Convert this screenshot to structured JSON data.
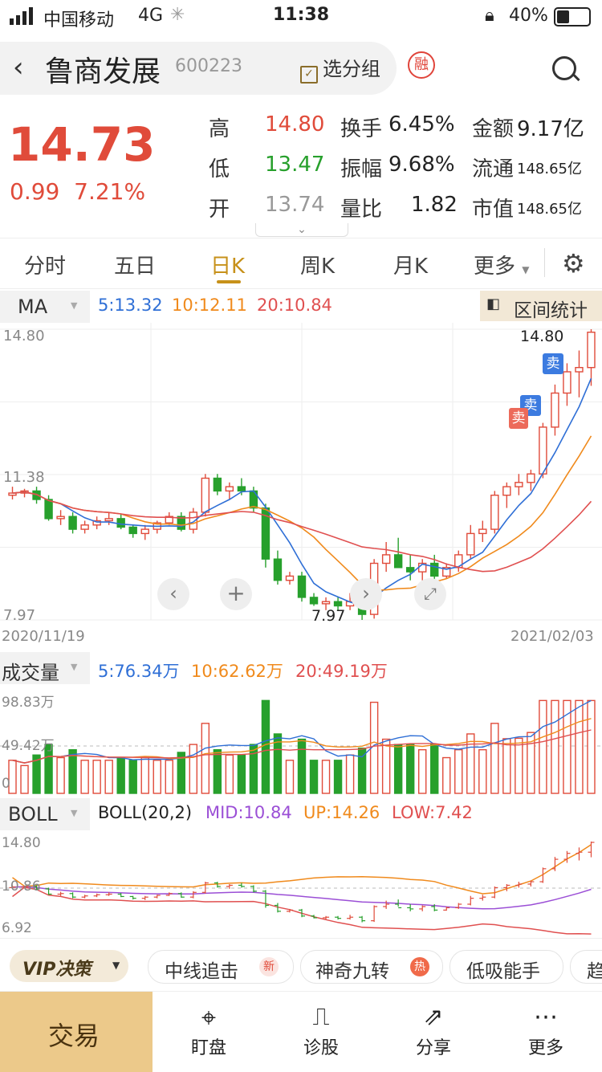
{
  "status": {
    "carrier": "中国移动",
    "network": "4G",
    "time": "11:38",
    "battery": "40%"
  },
  "header": {
    "title": "鲁商发展",
    "code": "600223",
    "group_label": "选分组",
    "rong": "融"
  },
  "quote": {
    "price": "14.73",
    "change": "0.99",
    "change_pct": "7.21%",
    "high_label": "高",
    "high": "14.80",
    "low_label": "低",
    "low": "13.47",
    "open_label": "开",
    "open": "13.74",
    "turnover_label": "换手",
    "turnover": "6.45%",
    "amplitude_label": "振幅",
    "amplitude": "9.68%",
    "ratio_label": "量比",
    "ratio": "1.82",
    "amount_label": "金额",
    "amount": "9.17亿",
    "float_label": "流通",
    "float_value": "148.65亿",
    "mcap_label": "市值",
    "mcap": "148.65亿"
  },
  "tabs": [
    "分时",
    "五日",
    "日K",
    "周K",
    "月K",
    "更多"
  ],
  "ma": {
    "label": "MA",
    "ma5": "5:13.32",
    "ma10": "10:12.11",
    "ma20": "20:10.84",
    "range_btn": "区间统计",
    "y_top": "14.80",
    "y_mid": "11.38",
    "y_bot": "7.97",
    "max_label": "14.80",
    "min_label": "7.97",
    "date_start": "2020/11/19",
    "date_end": "2021/02/03",
    "sell1": "卖",
    "sell2": "卖",
    "sell3": "卖"
  },
  "volume": {
    "label": "成交量",
    "v5": "5:76.34万",
    "v10": "10:62.62万",
    "v20": "20:49.19万",
    "y_top": "98.83万",
    "y_mid": "49.42万",
    "y_bot": "0"
  },
  "boll": {
    "label": "BOLL",
    "params": "BOLL(20,2)",
    "mid": "MID:10.84",
    "up": "UP:14.26",
    "low": "LOW:7.42",
    "y_top": "14.80",
    "y_mid": "10.86",
    "y_bot": "6.92"
  },
  "strategies": {
    "vip": "VIP决策",
    "items": [
      {
        "label": "中线追击",
        "badge": "新"
      },
      {
        "label": "神奇九转",
        "badge": "热"
      },
      {
        "label": "低吸能手",
        "badge": ""
      },
      {
        "label": "趋",
        "badge": ""
      }
    ]
  },
  "bottom": {
    "trade": "交易",
    "items": [
      "盯盘",
      "诊股",
      "分享",
      "更多"
    ]
  },
  "colors": {
    "up": "#e04b3a",
    "down": "#27a02c",
    "ma5": "#2f6fd6",
    "ma10": "#f08a1c",
    "ma20": "#e05050",
    "accent": "#c7911a",
    "mid": "#9b4fd6"
  },
  "chart_data": {
    "type": "candlestick",
    "ohlc": [
      [
        10.9,
        11.1,
        10.8,
        10.95
      ],
      [
        10.95,
        11.05,
        10.85,
        11.0
      ],
      [
        11.0,
        11.1,
        10.7,
        10.8
      ],
      [
        10.8,
        10.9,
        10.3,
        10.35
      ],
      [
        10.35,
        10.55,
        10.2,
        10.4
      ],
      [
        10.4,
        10.5,
        10.0,
        10.1
      ],
      [
        10.1,
        10.3,
        10.0,
        10.2
      ],
      [
        10.2,
        10.4,
        10.1,
        10.3
      ],
      [
        10.3,
        10.5,
        10.2,
        10.35
      ],
      [
        10.35,
        10.45,
        10.1,
        10.15
      ],
      [
        10.15,
        10.2,
        9.9,
        10.0
      ],
      [
        10.0,
        10.2,
        9.85,
        10.1
      ],
      [
        10.1,
        10.3,
        10.0,
        10.25
      ],
      [
        10.25,
        10.5,
        10.2,
        10.4
      ],
      [
        10.4,
        10.5,
        10.05,
        10.1
      ],
      [
        10.1,
        10.6,
        10.0,
        10.5
      ],
      [
        10.5,
        11.4,
        10.4,
        11.3
      ],
      [
        11.3,
        11.4,
        10.9,
        11.0
      ],
      [
        11.0,
        11.2,
        10.8,
        11.1
      ],
      [
        11.1,
        11.3,
        10.9,
        11.0
      ],
      [
        11.0,
        11.1,
        10.5,
        10.6
      ],
      [
        10.6,
        10.7,
        9.2,
        9.4
      ],
      [
        9.4,
        9.6,
        8.8,
        8.9
      ],
      [
        8.9,
        9.1,
        8.8,
        9.0
      ],
      [
        9.0,
        9.1,
        8.4,
        8.5
      ],
      [
        8.5,
        8.6,
        8.3,
        8.35
      ],
      [
        8.35,
        8.5,
        8.2,
        8.4
      ],
      [
        8.4,
        8.5,
        8.2,
        8.3
      ],
      [
        8.3,
        8.6,
        8.2,
        8.4
      ],
      [
        8.4,
        8.5,
        7.97,
        8.1
      ],
      [
        8.1,
        9.4,
        8.0,
        9.3
      ],
      [
        9.3,
        9.8,
        9.1,
        9.5
      ],
      [
        9.5,
        9.9,
        9.3,
        9.2
      ],
      [
        9.2,
        9.5,
        8.9,
        9.1
      ],
      [
        9.1,
        9.4,
        8.9,
        9.3
      ],
      [
        9.3,
        9.5,
        8.9,
        9.0
      ],
      [
        9.0,
        9.3,
        8.95,
        9.2
      ],
      [
        9.2,
        9.6,
        9.1,
        9.5
      ],
      [
        9.5,
        10.2,
        9.4,
        10.0
      ],
      [
        10.0,
        10.3,
        9.8,
        10.1
      ],
      [
        10.1,
        11.0,
        10.0,
        10.9
      ],
      [
        10.9,
        11.2,
        10.6,
        11.1
      ],
      [
        11.1,
        11.4,
        10.9,
        11.2
      ],
      [
        11.2,
        11.5,
        11.0,
        11.4
      ],
      [
        11.4,
        12.6,
        11.3,
        12.5
      ],
      [
        12.5,
        13.5,
        12.3,
        13.3
      ],
      [
        13.3,
        14.0,
        13.0,
        13.8
      ],
      [
        13.8,
        14.3,
        13.2,
        13.9
      ],
      [
        13.9,
        14.8,
        13.47,
        14.73
      ]
    ],
    "ma_y_range": [
      7.97,
      14.8
    ],
    "volume_y_max": 98.83,
    "boll_y_range": [
      6.92,
      14.8
    ]
  }
}
